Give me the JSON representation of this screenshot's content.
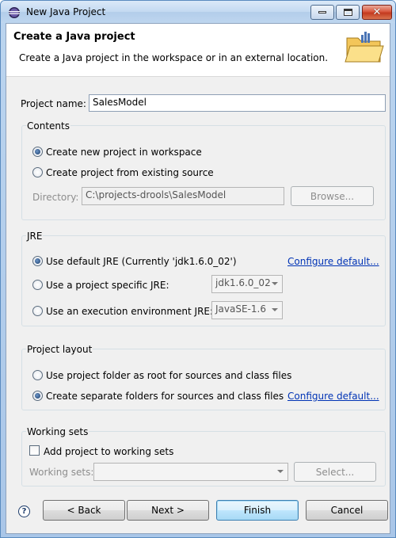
{
  "window": {
    "title": "New Java Project"
  },
  "header": {
    "title": "Create a Java project",
    "description": "Create a Java project in the workspace or in an external location."
  },
  "project": {
    "label": "Project name:",
    "value": "SalesModel"
  },
  "contents": {
    "title": "Contents",
    "option_new": "Create new project in workspace",
    "option_existing": "Create project from existing source",
    "directory_label": "Directory:",
    "directory_value": "C:\\projects-drools\\SalesModel",
    "browse_label": "Browse..."
  },
  "jre": {
    "title": "JRE",
    "option_default": "Use default JRE (Currently 'jdk1.6.0_02')",
    "configure_label": "Configure default...",
    "option_specific": "Use a project specific JRE:",
    "specific_value": "jdk1.6.0_02",
    "option_env": "Use an execution environment JRE:",
    "env_value": "JavaSE-1.6"
  },
  "layout": {
    "title": "Project layout",
    "option_root": "Use project folder as root for sources and class files",
    "option_separate": "Create separate folders for sources and class files",
    "configure_label": "Configure default..."
  },
  "working_sets": {
    "title": "Working sets",
    "add_label": "Add project to working sets",
    "sets_label": "Working sets:",
    "select_label": "Select..."
  },
  "footer": {
    "help": "?",
    "back_label": "< Back",
    "next_label": "Next >",
    "finish_label": "Finish",
    "cancel_label": "Cancel"
  },
  "colors": {
    "accent": "#0033b5",
    "window_frame": "#bcd5ef"
  }
}
